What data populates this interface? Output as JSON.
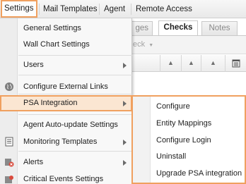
{
  "menubar": {
    "items": [
      "Settings",
      "Mail Templates",
      "Agent",
      "Remote Access"
    ]
  },
  "tabs": [
    "ges",
    "Checks",
    "Notes"
  ],
  "toolbar": {
    "dropdown_text": "eck"
  },
  "dropdown": {
    "items": [
      "General Settings",
      "Wall Chart Settings",
      "Users",
      "Configure External Links",
      "PSA Integration",
      "Agent Auto-update Settings",
      "Monitoring Templates",
      "Alerts",
      "Critical Events Settings"
    ]
  },
  "submenu": {
    "items": [
      "Configure",
      "Entity Mappings",
      "Configure Login",
      "Uninstall",
      "Upgrade PSA integration"
    ]
  },
  "colors": {
    "accent": "#f0a05f",
    "highlight_bg": "#fbe6d2"
  }
}
